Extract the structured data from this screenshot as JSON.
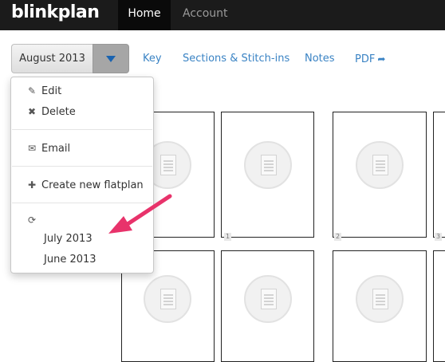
{
  "navbar": {
    "brand": "blinkplan",
    "home": "Home",
    "account": "Account"
  },
  "toolbar": {
    "month": "August 2013",
    "key": "Key",
    "sections": "Sections & Stitch-ins",
    "notes": "Notes",
    "pdf": "PDF",
    "pdf_icon": "share-arrow-icon"
  },
  "menu": {
    "edit": "Edit",
    "delete": "Delete",
    "email": "Email",
    "create": "Create new flatplan",
    "months": [
      "July 2013",
      "June 2013"
    ],
    "icons": {
      "edit": "pencil-square-icon",
      "delete": "x-icon",
      "email": "envelope-icon",
      "create": "plus-icon",
      "refresh": "refresh-icon"
    }
  },
  "pages": {
    "numbers": [
      "1",
      "2",
      "3"
    ]
  },
  "colors": {
    "navbar": "#1b1b1b",
    "link": "#3a83c4",
    "annotation_arrow": "#e8336b",
    "caret": "#1a63b0"
  }
}
